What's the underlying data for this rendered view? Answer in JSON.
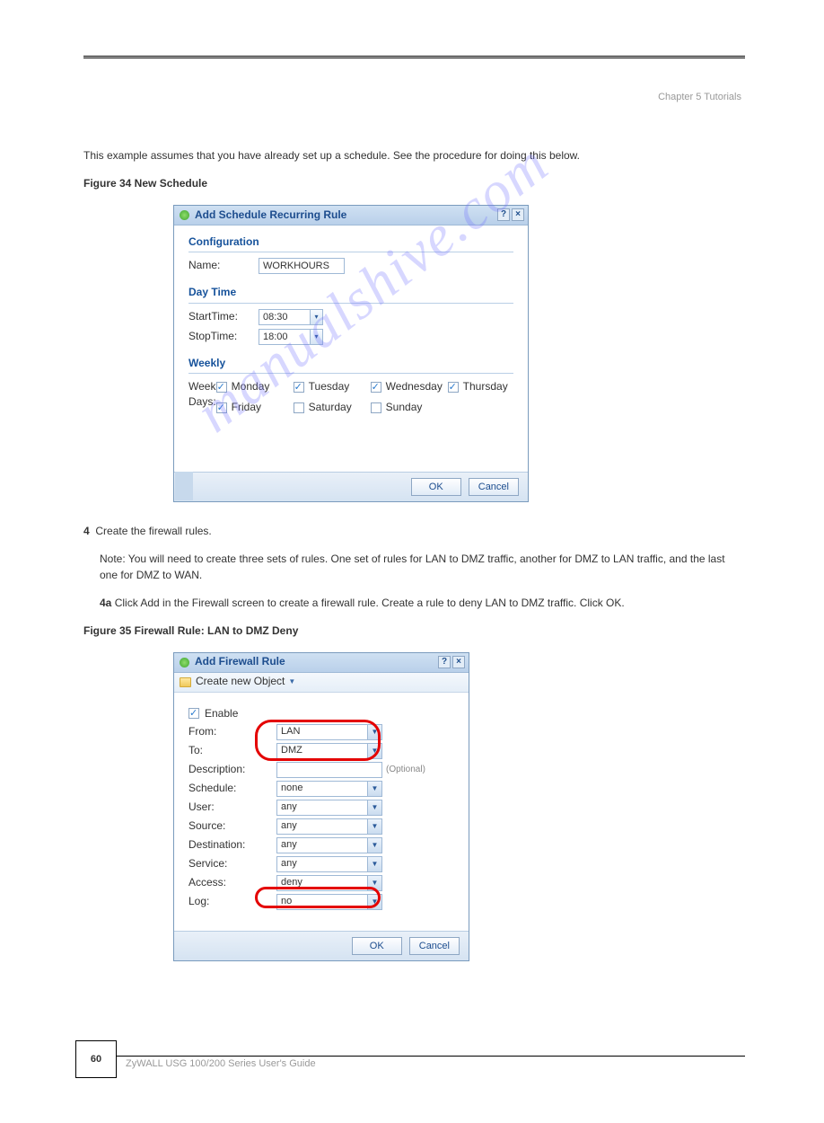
{
  "header": {
    "chapter_ref": "Chapter 5 Tutorials"
  },
  "watermark": "manualshive.com",
  "para1": "This example assumes that you have already set up a schedule. See the procedure for doing this below.",
  "fig_caption1": "Figure 34   New Schedule",
  "step4_intro": "Create the firewall rules.",
  "step4_text": "Note: You will need to create three sets of rules. One set of rules for LAN to DMZ traffic, another for DMZ to LAN traffic, and the last one for DMZ to WAN.",
  "step4_a": "Click Add in the Firewall screen to create a firewall rule. Create a rule to deny LAN to DMZ traffic. Click OK.",
  "fig_caption2": "Figure 35   Firewall Rule: LAN to DMZ Deny",
  "footer": {
    "page_num": "60",
    "guide": "ZyWALL USG 100/200 Series User's Guide"
  },
  "dlg1": {
    "title": "Add Schedule Recurring Rule",
    "help": "?",
    "close": "×",
    "sect_config": "Configuration",
    "name_label": "Name:",
    "name_value": "WORKHOURS",
    "sect_daytime": "Day Time",
    "starttime_label": "StartTime:",
    "starttime_value": "08:30",
    "stoptime_label": "StopTime:",
    "stoptime_value": "18:00",
    "sect_weekly": "Weekly",
    "weekdays_label": "Week Days:",
    "days": {
      "mon": "Monday",
      "tue": "Tuesday",
      "wed": "Wednesday",
      "thu": "Thursday",
      "fri": "Friday",
      "sat": "Saturday",
      "sun": "Sunday"
    },
    "ok": "OK",
    "cancel": "Cancel"
  },
  "dlg2": {
    "title": "Add Firewall Rule",
    "help": "?",
    "close": "×",
    "create_obj": "Create new Object",
    "enable": "Enable",
    "from_label": "From:",
    "from_value": "LAN",
    "to_label": "To:",
    "to_value": "DMZ",
    "desc_label": "Description:",
    "desc_value": "",
    "desc_hint": "(Optional)",
    "schedule_label": "Schedule:",
    "schedule_value": "none",
    "user_label": "User:",
    "user_value": "any",
    "source_label": "Source:",
    "source_value": "any",
    "dest_label": "Destination:",
    "dest_value": "any",
    "service_label": "Service:",
    "service_value": "any",
    "access_label": "Access:",
    "access_value": "deny",
    "log_label": "Log:",
    "log_value": "no",
    "ok": "OK",
    "cancel": "Cancel"
  }
}
